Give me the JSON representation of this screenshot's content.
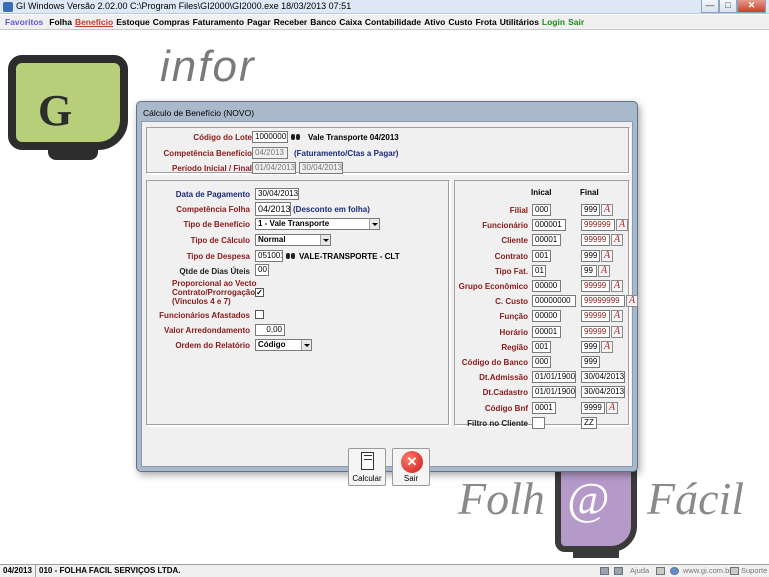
{
  "window": {
    "title": "GI Windows  Versão  2.02.00    C:\\Program Files\\GI2000\\GI2000.exe   18/03/2013 07:51",
    "min_glyph": "—",
    "max_glyph": "□",
    "close_glyph": "✕"
  },
  "menu": [
    {
      "label": "Favoritos",
      "style": "fav"
    },
    {
      "label": "Folha",
      "style": ""
    },
    {
      "label": "Benefício",
      "style": "active"
    },
    {
      "label": "Estoque",
      "style": ""
    },
    {
      "label": "Compras",
      "style": ""
    },
    {
      "label": "Faturamento",
      "style": ""
    },
    {
      "label": "Pagar",
      "style": ""
    },
    {
      "label": "Receber",
      "style": ""
    },
    {
      "label": "Banco",
      "style": ""
    },
    {
      "label": "Caixa",
      "style": ""
    },
    {
      "label": "Contabilidade",
      "style": ""
    },
    {
      "label": "Ativo",
      "style": ""
    },
    {
      "label": "Custo",
      "style": ""
    },
    {
      "label": "Frota",
      "style": ""
    },
    {
      "label": "Utilitários",
      "style": ""
    },
    {
      "label": "Login",
      "style": "green"
    },
    {
      "label": "Sair",
      "style": "green"
    }
  ],
  "logos": {
    "gi_mark": "G",
    "gi_word": "infor",
    "folha_left": "Folh",
    "folha_at": "@",
    "folha_right": "Fácil"
  },
  "dialog": {
    "title": "Cálculo de Benefício (NOVO)",
    "header": {
      "codigo_lote_label": "Código do Lote",
      "codigo_lote_value": "10000001",
      "codigo_lote_desc": "Vale Transporte 04/2013",
      "competencia_label": "Competência Benefício",
      "competencia_value": "04/2013",
      "competencia_note": "(Faturamento/Ctas a Pagar)",
      "periodo_label": "Período Inicial / Final",
      "periodo_inicial": "01/04/2013",
      "periodo_final": "30/04/2013"
    },
    "left": {
      "data_pagamento_label": "Data de Pagamento",
      "data_pagamento_value": "30/04/2013",
      "competencia_folha_label": "Competência Folha",
      "competencia_folha_value": "04/2013",
      "competencia_folha_note": "(Desconto em folha)",
      "tipo_beneficio_label": "Tipo de Benefício",
      "tipo_beneficio_value": "1 - Vale Transporte",
      "tipo_calculo_label": "Tipo de Cálculo",
      "tipo_calculo_value": "Normal",
      "tipo_despesa_label": "Tipo de Despesa",
      "tipo_despesa_code": "051001",
      "tipo_despesa_desc": "VALE-TRANSPORTE - CLT",
      "qtde_dias_label": "Qtde de Dias Úteis",
      "qtde_dias_value": "00",
      "proporcional_line1": "Proporcional ao Vecto",
      "proporcional_line2": "Contrato/Prorrogação",
      "proporcional_line3": "(Vínculos 4 e 7)",
      "proporcional_checked": "✓",
      "afastados_label": "Funcionários Afastados",
      "afastados_checked": "",
      "arredondamento_label": "Valor Arredondamento",
      "arredondamento_value": "0,00",
      "ordem_label": "Ordem do Relatório",
      "ordem_value": "Código"
    },
    "filters": {
      "col_inicial": "Inical",
      "col_final": "Final",
      "a_glyph": "A",
      "rows": [
        {
          "label": "Filial",
          "ini": "000",
          "fin": "999",
          "a": true,
          "color": "red"
        },
        {
          "label": "Funcionário",
          "ini": "000001",
          "fin": "999999",
          "a": true,
          "color": "red"
        },
        {
          "label": "Cliente",
          "ini": "00001",
          "fin": "99999",
          "a": true,
          "color": "red"
        },
        {
          "label": "Contrato",
          "ini": "001",
          "fin": "999",
          "a": true,
          "color": "red"
        },
        {
          "label": "Tipo Fat.",
          "ini": "01",
          "fin": "99",
          "a": true,
          "color": "red"
        },
        {
          "label": "Grupo Econômico",
          "ini": "00000",
          "fin": "99999",
          "a": true,
          "color": "red"
        },
        {
          "label": "C. Custo",
          "ini": "00000000",
          "fin": "99999999",
          "a": true,
          "color": "red"
        },
        {
          "label": "Função",
          "ini": "00000",
          "fin": "99999",
          "a": true,
          "color": "red"
        },
        {
          "label": "Horário",
          "ini": "00001",
          "fin": "99999",
          "a": true,
          "color": "red"
        },
        {
          "label": "Região",
          "ini": "001",
          "fin": "999",
          "a": true,
          "color": "red"
        },
        {
          "label": "Código do Banco",
          "ini": "000",
          "fin": "999",
          "a": false,
          "color": "red"
        },
        {
          "label": "Dt.Admissão",
          "ini": "01/01/1900",
          "fin": "30/04/2013",
          "a": false,
          "color": "red"
        },
        {
          "label": "Dt.Cadastro",
          "ini": "01/01/1900",
          "fin": "30/04/2013",
          "a": false,
          "color": "red"
        },
        {
          "label": "Código Bnf",
          "ini": "0001",
          "fin": "9999",
          "a": true,
          "color": "red"
        },
        {
          "label": "Filtro no Cliente",
          "ini": "",
          "fin": "ZZ",
          "a": false,
          "color": "dark"
        }
      ]
    },
    "buttons": {
      "calcular": "Calcular",
      "sair": "Sair",
      "sair_glyph": "✕"
    }
  },
  "statusbar": {
    "competencia": "04/2013",
    "empresa": "010 - FOLHA FACIL SERVIÇOS LTDA.",
    "ajuda": "Ajuda",
    "site": "www.gi.com.br",
    "suporte": "Suporte"
  }
}
